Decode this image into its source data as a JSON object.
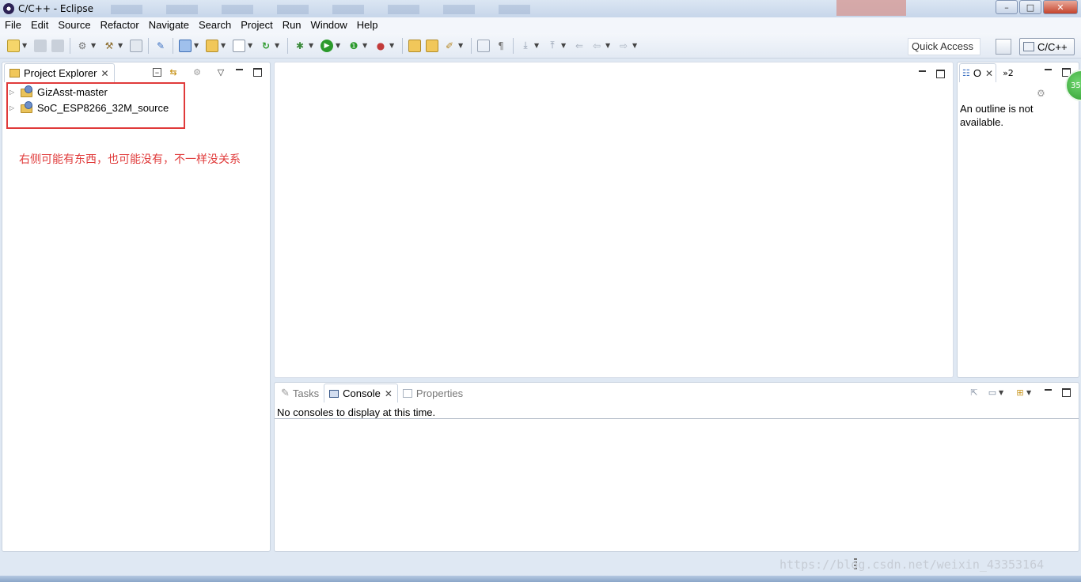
{
  "window": {
    "title": "C/C++ - Eclipse",
    "controls": {
      "minimize": "–",
      "maximize": "□",
      "close": "✕"
    }
  },
  "menubar": [
    "File",
    "Edit",
    "Source",
    "Refactor",
    "Navigate",
    "Search",
    "Project",
    "Run",
    "Window",
    "Help"
  ],
  "toolbar": {
    "quick_access_placeholder": "Quick Access",
    "perspective_label": "C/C++"
  },
  "project_explorer": {
    "tab_label": "Project Explorer",
    "items": [
      {
        "label": "GizAsst-master"
      },
      {
        "label": "SoC_ESP8266_32M_source"
      }
    ],
    "annotation": "右侧可能有东西，也可能没有，不一样没关系"
  },
  "outline": {
    "tab_label": "O",
    "overflow_label": "»2",
    "message": "An outline is not available."
  },
  "bottom_panel": {
    "tabs": [
      {
        "label": "Tasks",
        "active": false
      },
      {
        "label": "Console",
        "active": true
      },
      {
        "label": "Properties",
        "active": false
      }
    ],
    "console_message": "No consoles to display at this time."
  },
  "badge": {
    "text": "35"
  },
  "watermark": "https://blog.csdn.net/weixin_43353164",
  "colors": {
    "annotation_red": "#e03a3a",
    "title_bar": "#c7d6ea",
    "run_green": "#2c9a2c"
  }
}
